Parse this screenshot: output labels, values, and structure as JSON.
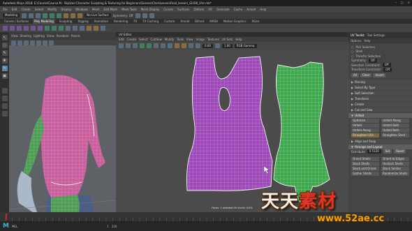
{
  "window": {
    "title": "Autodesk Maya 2018: E:\\Course\\Course M - Stylized Character Sculpting & Texturing for Beginners\\Scenes\\Char\\Lesson\\Final_lesson\\_Girl06_UVs.mb*",
    "controls": [
      "–",
      "□",
      "×"
    ]
  },
  "menubar": {
    "items": [
      "File",
      "Edit",
      "Create",
      "Select",
      "Modify",
      "Display",
      "Windows",
      "Mesh",
      "Edit Mesh",
      "Mesh Tools",
      "Mesh Display",
      "Curves",
      "Surfaces",
      "Deform",
      "UV",
      "Generate",
      "Cache",
      "Arnold",
      "Help"
    ]
  },
  "statusline": {
    "mode": "Modeling",
    "live_surface": "No Live Surface",
    "symmetry": "Symmetry: Off"
  },
  "shelf": {
    "tabs": [
      "Curves / Surfaces",
      "Poly Modeling",
      "Sculpting",
      "Rigging",
      "Animation",
      "Rendering",
      "FX",
      "FX Caching",
      "Custom",
      "Arnold",
      "Bifrost",
      "MASH",
      "Motion Graphics",
      "XGen"
    ],
    "active": "Poly Modeling"
  },
  "viewport": {
    "menu": [
      "View",
      "Shading",
      "Lighting",
      "Show",
      "Renderer",
      "Panels"
    ]
  },
  "uv_editor": {
    "title": "UV Editor",
    "menu": [
      "Edit",
      "Create",
      "Select",
      "Cut/Sew",
      "Modify",
      "Tools",
      "View",
      "Image",
      "Textures",
      "UV Sets",
      "Help"
    ],
    "field_value": "0.00",
    "field_value2": "1.00",
    "colorspace": "RGB Gamma",
    "selection_text": "Faces: 1 selected UV shells: 0.0%"
  },
  "toolkit": {
    "tabs": [
      "UV Toolkit",
      "Tool Settings"
    ],
    "sub": [
      "Options",
      "Help"
    ],
    "pick_options": [
      "Pick Selection",
      "Shell",
      "Transfer Selection"
    ],
    "rows": [
      {
        "label": "Symmetry:",
        "value": "Off"
      },
      {
        "label": "Selection Constraint:",
        "value": "Off"
      },
      {
        "label": "Transform Constraint:",
        "value": "Off"
      }
    ],
    "buttons": [
      "All",
      "Clear",
      "Invert"
    ],
    "sections_top": [
      "Pinning",
      "Select By Type",
      "Soft Selection",
      "Transform",
      "Create",
      "Cut and Sew",
      "Unfold"
    ],
    "unfold_grid": [
      "Optimize",
      "Unfold Along",
      "Unfold",
      "Unfold Both",
      "Unfold Along",
      "Unfold Both",
      "Straighten UVs",
      "Straighten Shell"
    ],
    "sections_mid": [
      "Align and Snap",
      "Arrange and Layout"
    ],
    "distribute_label": "Distribute",
    "texel_value": "0.5120",
    "texel_btn": "Set",
    "texel_btn2": "Reset",
    "layout_grid": [
      "Orient Shells",
      "Orient to Edges",
      "Stack Shells",
      "Unstack Shells",
      "Stack and Orient",
      "Stack Similar",
      "Gather Shells",
      "Randomize Shells"
    ]
  },
  "timeline": {
    "start": "1",
    "end": "120"
  },
  "command_line": {
    "label": "MEL",
    "app_logo": "M"
  },
  "watermark": {
    "text_white": "天天",
    "text_red": "素材",
    "url": "www.52ae.cc"
  },
  "colors": {
    "uv_shell_front": "#9e4ab8",
    "uv_shell_back": "#3fa84f",
    "mesh_pink": "#c9609e",
    "mesh_green": "#4e9e55"
  }
}
